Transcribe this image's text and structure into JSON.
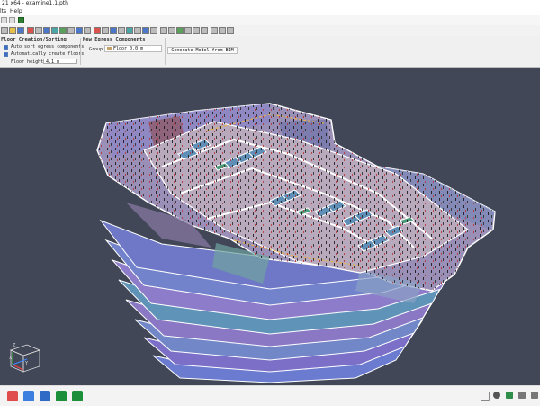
{
  "window": {
    "title": "21 x64 - examine1.1.pth"
  },
  "menu": {
    "items": [
      "lts",
      "Help"
    ]
  },
  "ribbon": {
    "floor_creation": {
      "title": "Floor Creation/Sorting",
      "auto_sort_label": "Auto sort egress components",
      "auto_create_label": "Automatically create floors",
      "floor_height_label": "Floor height",
      "floor_height_value": "4.1 m"
    },
    "new_egress": {
      "title": "New Egress Components",
      "group_label": "Group",
      "group_value": "Floor 0.0 m"
    },
    "generate": {
      "label": "Generate Model from BIM"
    }
  },
  "viewcube": {
    "axis_x": "X",
    "axis_y": "Y",
    "axis_z": "Z"
  },
  "colors": {
    "accent": "#3c6fc4",
    "viewport_bg": "#414757"
  }
}
